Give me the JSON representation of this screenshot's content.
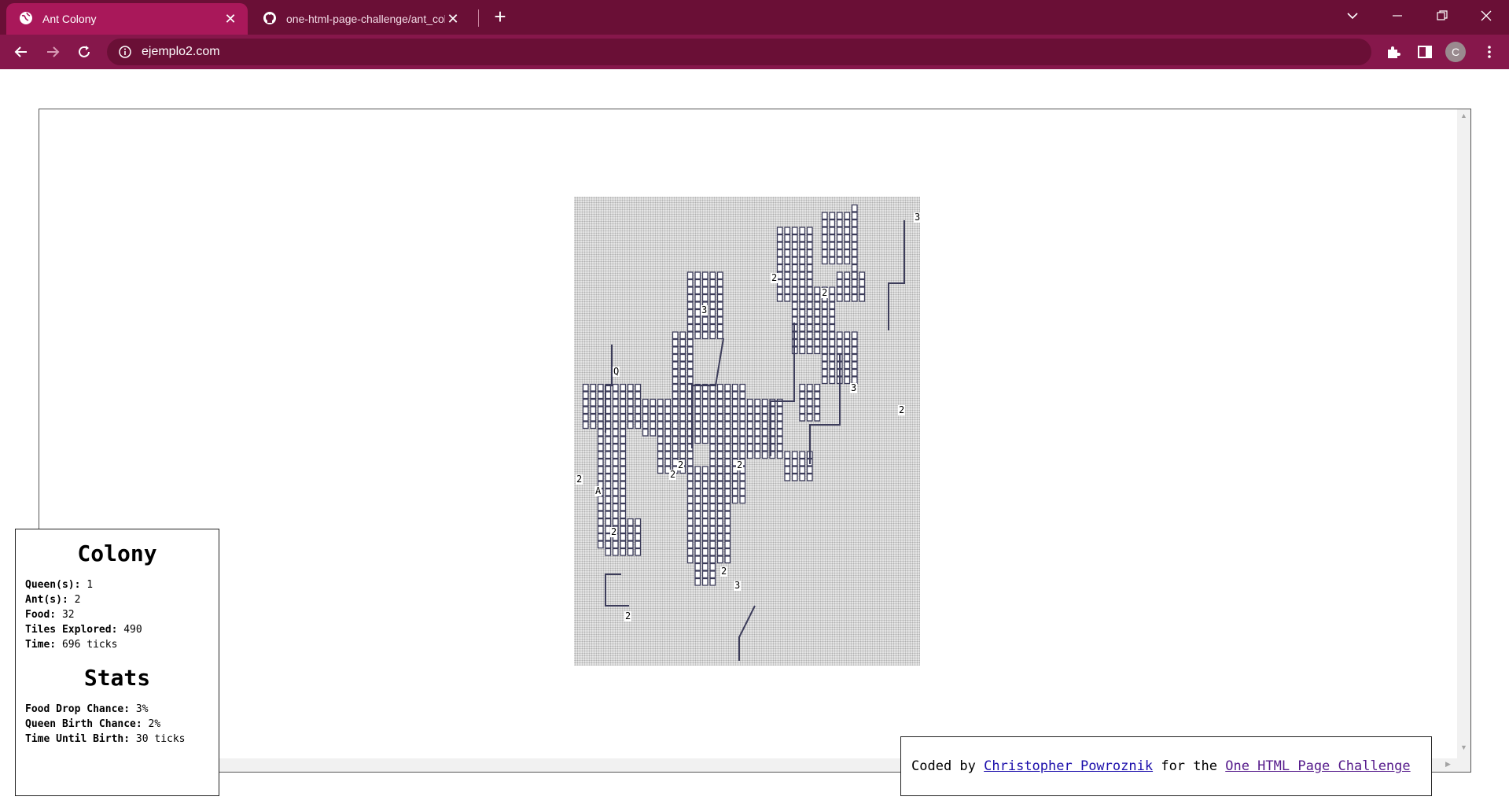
{
  "browser": {
    "tabs": [
      {
        "title": "Ant Colony",
        "icon": "globe-icon",
        "active": true
      },
      {
        "title": "one-html-page-challenge/ant_colony",
        "icon": "github-icon",
        "active": false
      }
    ],
    "url": "ejemplo2.com",
    "profile_initial": "C",
    "colors": {
      "tabstrip": "#6a0f36",
      "active_tab": "#a9185a",
      "toolbar": "#86174b"
    }
  },
  "colony": {
    "title": "Colony",
    "rows": [
      {
        "label": "Queen(s):",
        "value": "1"
      },
      {
        "label": "Ant(s):",
        "value": "2"
      },
      {
        "label": "Food:",
        "value": "32"
      },
      {
        "label": "Tiles Explored:",
        "value": "490"
      },
      {
        "label": "Time:",
        "value": "696 ticks"
      }
    ]
  },
  "stats": {
    "title": "Stats",
    "rows": [
      {
        "label": "Food Drop Chance:",
        "value": "3%"
      },
      {
        "label": "Queen Birth Chance:",
        "value": "2%"
      },
      {
        "label": "Time Until Birth:",
        "value": "30 ticks"
      }
    ]
  },
  "credit": {
    "prefix": "Coded by",
    "author": "Christopher Powroznik",
    "middle": "for the",
    "challenge": "One HTML Page Challenge"
  },
  "map": {
    "labels": [
      "3",
      "2",
      "2",
      "3",
      "Q",
      "3",
      "2",
      "2",
      "2",
      "2",
      "2",
      "A",
      "2",
      "2",
      "3",
      "2"
    ]
  }
}
